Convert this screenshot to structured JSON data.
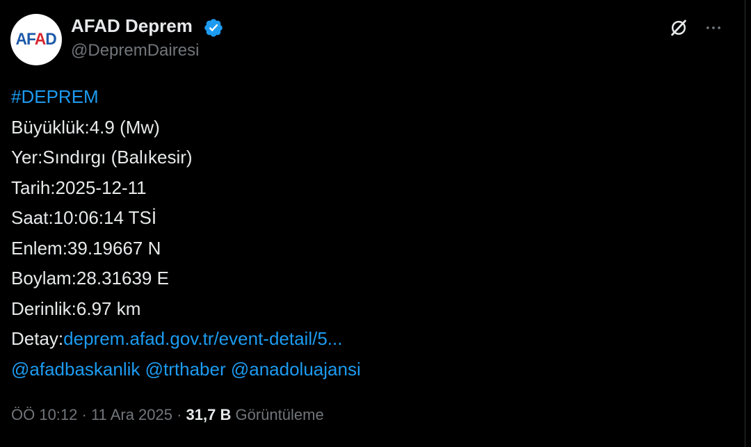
{
  "author": {
    "avatar_text_blue": "AF",
    "avatar_text_red": "A",
    "avatar_text_blue2": "D",
    "display_name": "AFAD Deprem",
    "handle": "@DepremDairesi",
    "verified_icon": "verified-badge-icon"
  },
  "actions": {
    "grok_icon": "grok-icon",
    "more_icon": "more-icon"
  },
  "tweet": {
    "hashtag": "#DEPREM",
    "magnitude": "Büyüklük:4.9 (Mw)",
    "location": "Yer:Sındırgı (Balıkesir)",
    "date": "Tarih:2025-12-11",
    "time": "Saat:10:06:14 TSİ",
    "latitude": "Enlem:39.19667 N",
    "longitude": "Boylam:28.31639 E",
    "depth": "Derinlik:6.97 km",
    "detail_label": "Detay:",
    "detail_link": "deprem.afad.gov.tr/event-detail/5...",
    "mention_1": "@afadbaskanlik",
    "mention_2": "@trthaber",
    "mention_3": "@anadoluajansi"
  },
  "meta": {
    "time": "ÖÖ 10:12",
    "separator": " · ",
    "date": "11 Ara 2025",
    "views_count": "31,7 B",
    "views_label": "Görüntüleme"
  },
  "colors": {
    "background": "#000000",
    "text": "#e7e9ea",
    "secondary": "#71767b",
    "link": "#1d9bf0",
    "verified": "#1d9bf0"
  }
}
